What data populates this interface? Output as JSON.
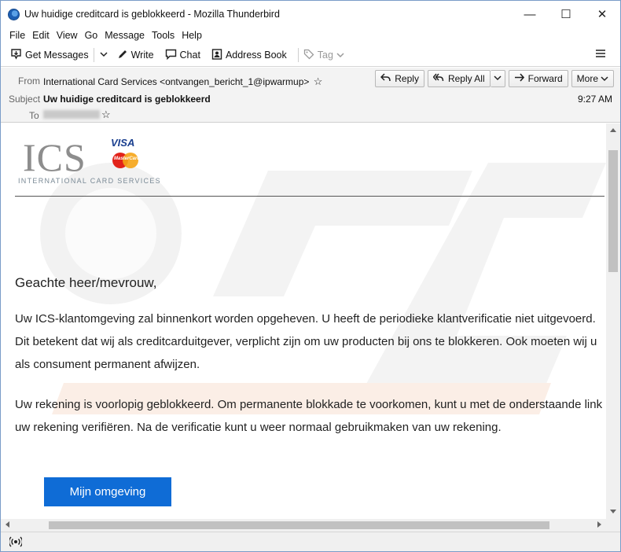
{
  "window": {
    "title": "Uw huidige creditcard is geblokkeerd - Mozilla Thunderbird",
    "controls": {
      "minimize": "—",
      "maximize": "☐",
      "close": "✕"
    }
  },
  "menu": [
    "File",
    "Edit",
    "View",
    "Go",
    "Message",
    "Tools",
    "Help"
  ],
  "toolbar": {
    "get_messages": "Get Messages",
    "write": "Write",
    "chat": "Chat",
    "address_book": "Address Book",
    "tag": "Tag"
  },
  "header": {
    "from_label": "From",
    "from_value": "International Card Services <ontvangen_bericht_1@ipwarmup>",
    "subject_label": "Subject",
    "subject_value": "Uw huidige creditcard is geblokkeerd",
    "to_label": "To",
    "time": "9:27 AM",
    "buttons": {
      "reply": "Reply",
      "reply_all": "Reply All",
      "forward": "Forward",
      "more": "More"
    }
  },
  "email": {
    "logo_text": "ICS",
    "logo_subtitle": "INTERNATIONAL CARD SERVICES",
    "visa": "VISA",
    "mastercard": "MasterCard",
    "greeting": "Geachte heer/mevrouw,",
    "paragraph1": "Uw ICS-klantomgeving zal binnenkort worden opgeheven. U heeft de periodieke klantverificatie niet uitgevoerd. Dit betekent dat wij als creditcarduitgever, verplicht zijn om uw producten bij ons te blokkeren. Ook moeten wij u als consument permanent afwijzen.",
    "paragraph2": "Uw rekening is voorlopig geblokkeerd. Om permanente blokkade te voorkomen, kunt u met de onderstaande link uw rekening verifiëren. Na de verificatie kunt u weer normaal gebruikmaken van uw rekening.",
    "cta_label": "Mijn omgeving"
  },
  "colors": {
    "cta": "#0f6cd6",
    "header_bg": "#f3f3f3"
  }
}
